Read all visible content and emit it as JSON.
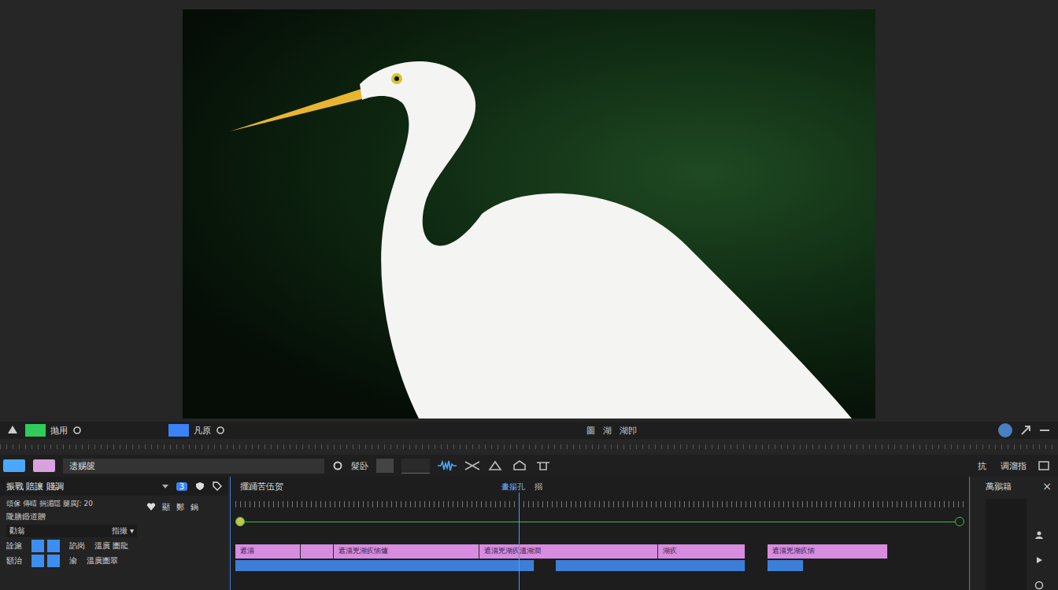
{
  "toolbar": {
    "items": [
      {
        "label": "抛用",
        "color": "#2ecc5a"
      },
      {
        "label": "凡原",
        "color": "#3b82f6"
      }
    ],
    "right_labels": [
      "圖",
      "湖",
      "湖卽"
    ]
  },
  "edit_bar": {
    "swatches": [
      {
        "color": "#4aa8ff"
      },
      {
        "color": "#d7a2de"
      }
    ],
    "field": "遗赐篋",
    "value_label": "髮卧",
    "buttons": [
      "抗",
      "调溜指"
    ]
  },
  "left_panel": {
    "title": "振戰 賠讓 賤調",
    "badge": "3",
    "subtitle": "頌傢 傳晴 捐湄隱 腿廣ʃ: 20",
    "section": "隴膳鍲道贈",
    "field": {
      "label": "勸翁",
      "value": "指撮"
    },
    "tools": [
      "顯",
      "鄭",
      "鍋"
    ],
    "rows": [
      {
        "label": "詮滬",
        "a": "諂岗",
        "b": "溫廣 圕龍"
      },
      {
        "label": "額治",
        "a": "渝",
        "b": "溫廣圕翠"
      }
    ]
  },
  "timeline": {
    "title": "擺踊苦伍贺",
    "playhead_label": "畫揚孔",
    "playhead_extra": "搦",
    "playhead": 0.39,
    "clips": [
      {
        "start": 0,
        "end": 9,
        "label": "遮淄",
        "color": "#d78ce0"
      },
      {
        "start": 9,
        "end": 13.5,
        "label": "",
        "color": "#d78ce0"
      },
      {
        "start": 13.5,
        "end": 33.5,
        "label": "遮淄兇湖疚恼爐",
        "color": "#d78ce0"
      },
      {
        "start": 33.5,
        "end": 58,
        "label": "遮淄兇湖疚溫湖澗",
        "color": "#d78ce0"
      },
      {
        "start": 58,
        "end": 70,
        "label": "湖疚",
        "color": "#d78ce0"
      },
      {
        "start": 73,
        "end": 89.5,
        "label": "遮淄兇湖疚恼",
        "color": "#d78ce0"
      }
    ],
    "blue_clips": [
      {
        "start": 0,
        "end": 41
      },
      {
        "start": 44,
        "end": 70
      },
      {
        "start": 73,
        "end": 78
      }
    ]
  },
  "right_panel": {
    "title": "萬鶸籍",
    "close": "×"
  }
}
